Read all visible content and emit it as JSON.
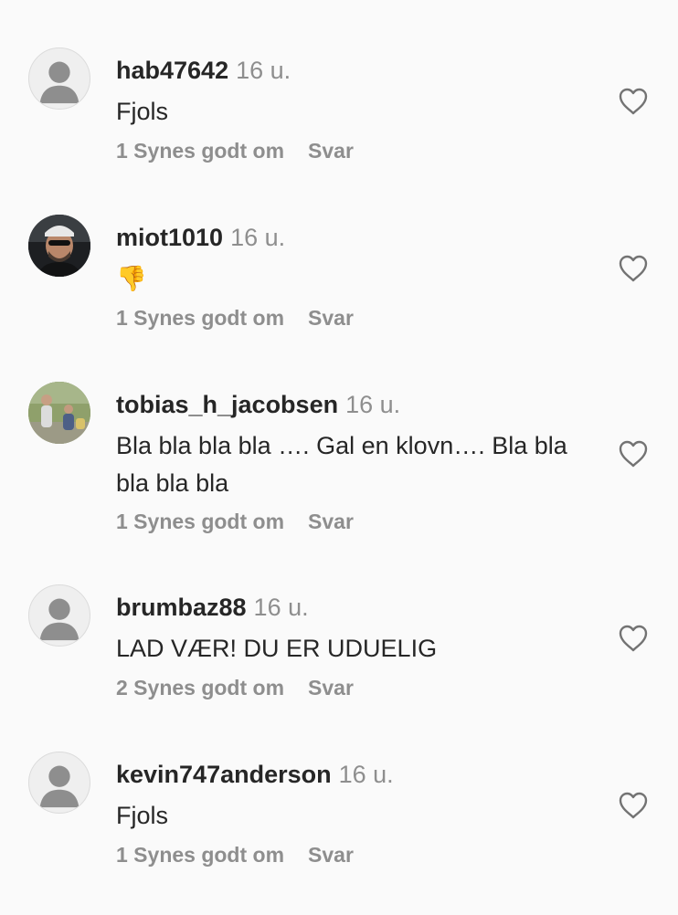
{
  "comments": [
    {
      "username": "hab47642",
      "time": "16 u.",
      "text": "Fjols",
      "likes": "1 Synes godt om",
      "reply": "Svar",
      "avatar": "default-avatar"
    },
    {
      "username": "miot1010",
      "time": "16 u.",
      "text": "👎",
      "likes": "1 Synes godt om",
      "reply": "Svar",
      "avatar": "photo-avatar"
    },
    {
      "username": "tobias_h_jacobsen",
      "time": "16 u.",
      "text": "Bla bla bla bla …. Gal en klovn…. Bla bla bla bla bla",
      "likes": "1 Synes godt om",
      "reply": "Svar",
      "avatar": "photo-avatar"
    },
    {
      "username": "brumbaz88",
      "time": "16 u.",
      "text": "LAD VÆR! DU ER UDUELIG",
      "likes": "2 Synes godt om",
      "reply": "Svar",
      "avatar": "default-avatar"
    },
    {
      "username": "kevin747anderson",
      "time": "16 u.",
      "text": "Fjols",
      "likes": "1 Synes godt om",
      "reply": "Svar",
      "avatar": "default-avatar"
    }
  ],
  "icons": {
    "like": "heart-outline-icon"
  },
  "colors": {
    "username": "#262626",
    "meta": "#8e8e8e",
    "background": "#fafafa"
  }
}
